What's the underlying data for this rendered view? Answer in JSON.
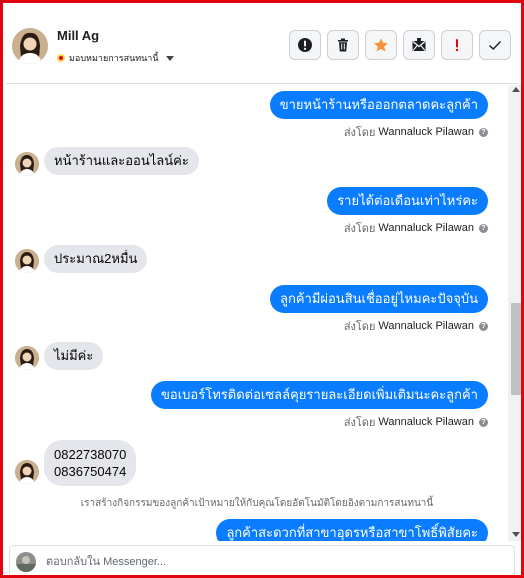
{
  "header": {
    "contact_name": "Mill Ag",
    "assign_label": "มอบหมายการสนทนานี้",
    "actions": [
      "alert-circle-icon",
      "trash-icon",
      "star-icon",
      "mark-unread-icon",
      "spam-icon",
      "check-icon"
    ],
    "star_color": "#f7923b",
    "spam_color": "#e0060f"
  },
  "conversation": {
    "messages": [
      {
        "direction": "out",
        "text": "ขายหน้าร้านหรือออกตลาดคะลูกค้า",
        "sent_by_prefix": "ส่งโดย",
        "sent_by_name": "Wannaluck Pilawan"
      },
      {
        "direction": "in",
        "text": "หน้าร้านและออนไลน์ค่ะ"
      },
      {
        "direction": "out",
        "text": "รายได้ต่อเดือนเท่าไหร่คะ",
        "sent_by_prefix": "ส่งโดย",
        "sent_by_name": "Wannaluck Pilawan"
      },
      {
        "direction": "in",
        "text": "ประมาณ2หมื่น"
      },
      {
        "direction": "out",
        "text": "ลูกค้ามีผ่อนสินเชื่ออยู่ไหมคะปัจจุบัน",
        "sent_by_prefix": "ส่งโดย",
        "sent_by_name": "Wannaluck Pilawan"
      },
      {
        "direction": "in",
        "text": "ไม่มีค่ะ"
      },
      {
        "direction": "out",
        "text": "ขอเบอร์โทรติดต่อเซลล์คุยรายละเอียดเพิ่มเติมนะคะลูกค้า",
        "sent_by_prefix": "ส่งโดย",
        "sent_by_name": "Wannaluck Pilawan"
      },
      {
        "direction": "in",
        "lines": [
          "0822738070",
          "0836750474"
        ]
      },
      {
        "direction": "out",
        "text": "ลูกค้าสะดวกที่สาขาอุดรหรือสาขาโพธิ์พิสัยคะ"
      }
    ],
    "notice": "เราสร้างกิจกรรมของลูกค้าเป้าหมายให้กับคุณโดยอัตโนมัติโดยอิงตามการสนทนานี้",
    "outgoing_color": "#0a7cff",
    "incoming_color": "#e4e6eb"
  },
  "reply": {
    "placeholder": "ตอบกลับใน Messenger..."
  }
}
